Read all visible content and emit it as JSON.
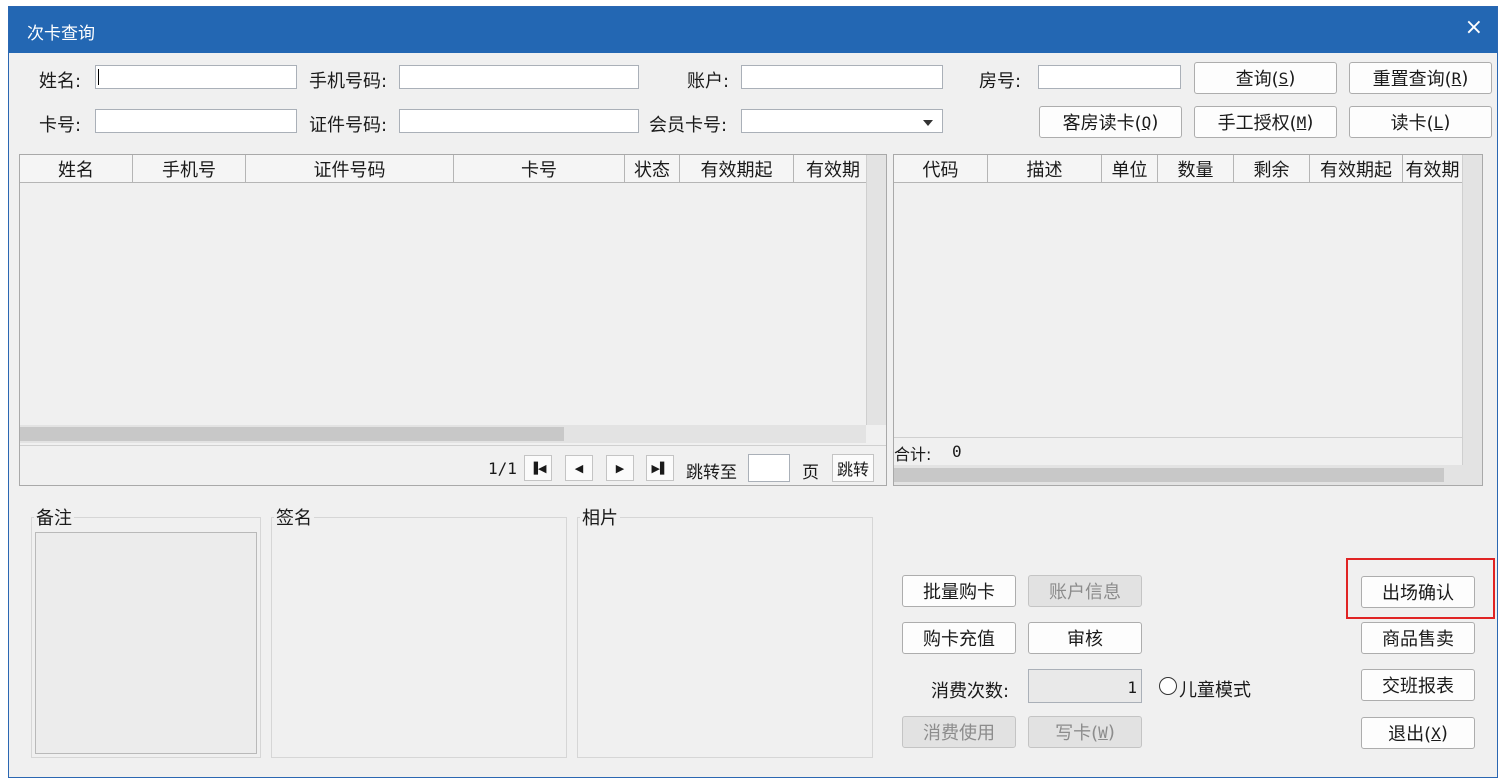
{
  "window": {
    "title": "次卡查询",
    "close_icon": "×"
  },
  "search": {
    "name_label": "姓名:",
    "phone_label": "手机号码:",
    "account_label": "账户:",
    "room_label": "房号:",
    "card_label": "卡号:",
    "id_label": "证件号码:",
    "member_label": "会员卡号:",
    "name_value": "",
    "phone_value": "",
    "account_value": "",
    "room_value": "",
    "card_value": "",
    "id_value": "",
    "member_value": ""
  },
  "buttons": {
    "query": {
      "text": "查询(",
      "key": "S",
      "close": ")"
    },
    "reset": {
      "text": "重置查询(",
      "key": "R",
      "close": ")"
    },
    "room_read": {
      "text": "客房读卡(",
      "key": "Q",
      "close": ")"
    },
    "manual_auth": {
      "text": "手工授权(",
      "key": "M",
      "close": ")"
    },
    "read_card": {
      "text": "读卡(",
      "key": "L",
      "close": ")"
    },
    "batch_buy": "批量购卡",
    "account_info": "账户信息",
    "recharge": "购卡充值",
    "audit": "审核",
    "consume_use": "消费使用",
    "write_card": {
      "text": "写卡(",
      "key": "W",
      "close": ")"
    },
    "exit_confirm": "出场确认",
    "goods_sale": "商品售卖",
    "shift_report": "交班报表",
    "exit": {
      "text": "退出(",
      "key": "X",
      "close": ")"
    }
  },
  "left_table": {
    "columns": [
      "姓名",
      "手机号",
      "证件号码",
      "卡号",
      "状态",
      "有效期起",
      "有效期"
    ]
  },
  "right_table": {
    "columns": [
      "代码",
      "描述",
      "单位",
      "数量",
      "剩余",
      "有效期起",
      "有效期"
    ],
    "total_label": "合计:",
    "total_value": "0"
  },
  "pager": {
    "page_info": "1/1",
    "jump_to_label": "跳转至",
    "page_label": "页",
    "jump_button": "跳转",
    "jump_value": ""
  },
  "groups": {
    "remark": "备注",
    "signature": "签名",
    "photo": "相片"
  },
  "consume": {
    "count_label": "消费次数:",
    "count_value": "1",
    "child_mode_label": "儿童模式",
    "child_mode_checked": false
  },
  "colors": {
    "titlebar": "#2367b3",
    "highlight": "#e02424"
  }
}
